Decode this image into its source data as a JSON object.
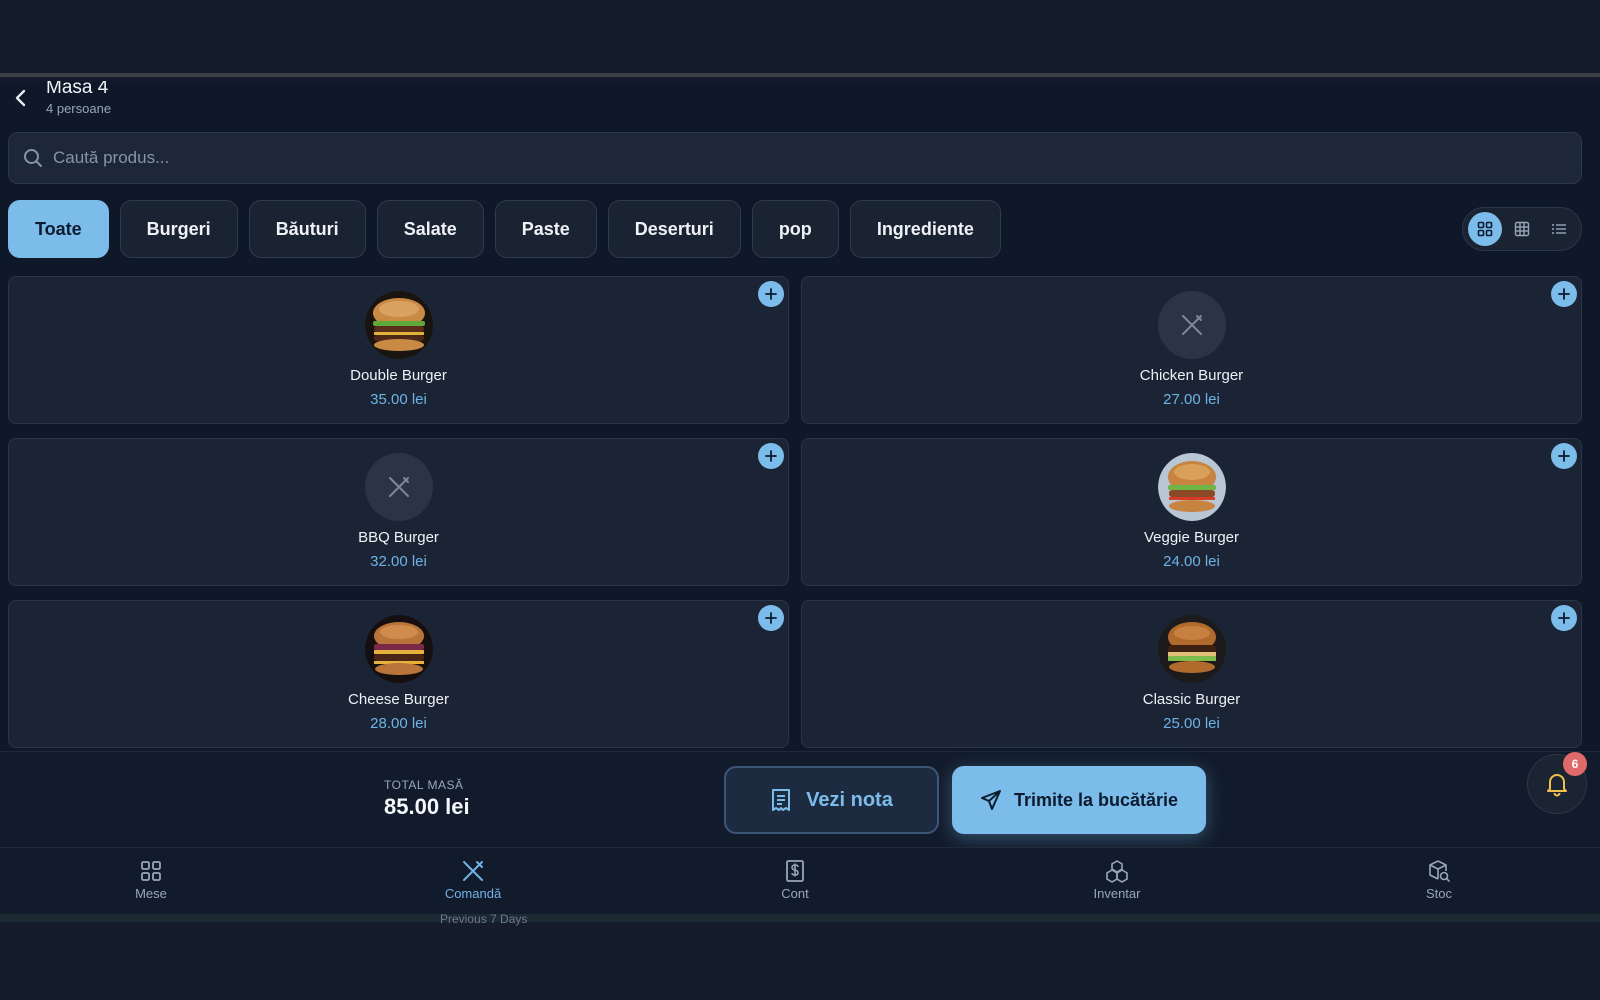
{
  "header": {
    "title": "Masa 4",
    "subtitle": "4 persoane"
  },
  "search": {
    "placeholder": "Caută produs..."
  },
  "categories": [
    {
      "label": "Toate",
      "active": true
    },
    {
      "label": "Burgeri"
    },
    {
      "label": "Băuturi"
    },
    {
      "label": "Salate"
    },
    {
      "label": "Paste"
    },
    {
      "label": "Deserturi"
    },
    {
      "label": "pop"
    },
    {
      "label": "Ingrediente"
    }
  ],
  "view_modes": [
    "grid-large-icon",
    "grid-small-icon",
    "list-icon"
  ],
  "products": [
    {
      "name": "Double Burger",
      "price": "35.00 lei",
      "image": "burger-photo"
    },
    {
      "name": "Chicken Burger",
      "price": "27.00 lei",
      "image": "placeholder-utensils-icon"
    },
    {
      "name": "BBQ Burger",
      "price": "32.00 lei",
      "image": "placeholder-utensils-icon"
    },
    {
      "name": "Veggie Burger",
      "price": "24.00 lei",
      "image": "burger-photo"
    },
    {
      "name": "Cheese Burger",
      "price": "28.00 lei",
      "image": "burger-photo"
    },
    {
      "name": "Classic Burger",
      "price": "25.00 lei",
      "image": "burger-photo"
    }
  ],
  "footer": {
    "total_label": "TOTAL MASĂ",
    "total_value": "85.00 lei",
    "view_bill": "Vezi nota",
    "send_kitchen": "Trimite la bucătărie",
    "notifications_count": "6"
  },
  "nav": [
    {
      "label": "Mese",
      "icon": "grid-icon"
    },
    {
      "label": "Comandă",
      "icon": "utensils-icon",
      "active": true
    },
    {
      "label": "Cont",
      "icon": "receipt-dollar-icon"
    },
    {
      "label": "Inventar",
      "icon": "boxes-icon"
    },
    {
      "label": "Stoc",
      "icon": "package-search-icon"
    }
  ],
  "background_peek_text": "Previous 7 Days",
  "colors": {
    "accent": "#7cbcea",
    "background": "#0f1828",
    "card": "#1b2434",
    "badge": "#e06a6a",
    "price": "#6fb2e6"
  }
}
